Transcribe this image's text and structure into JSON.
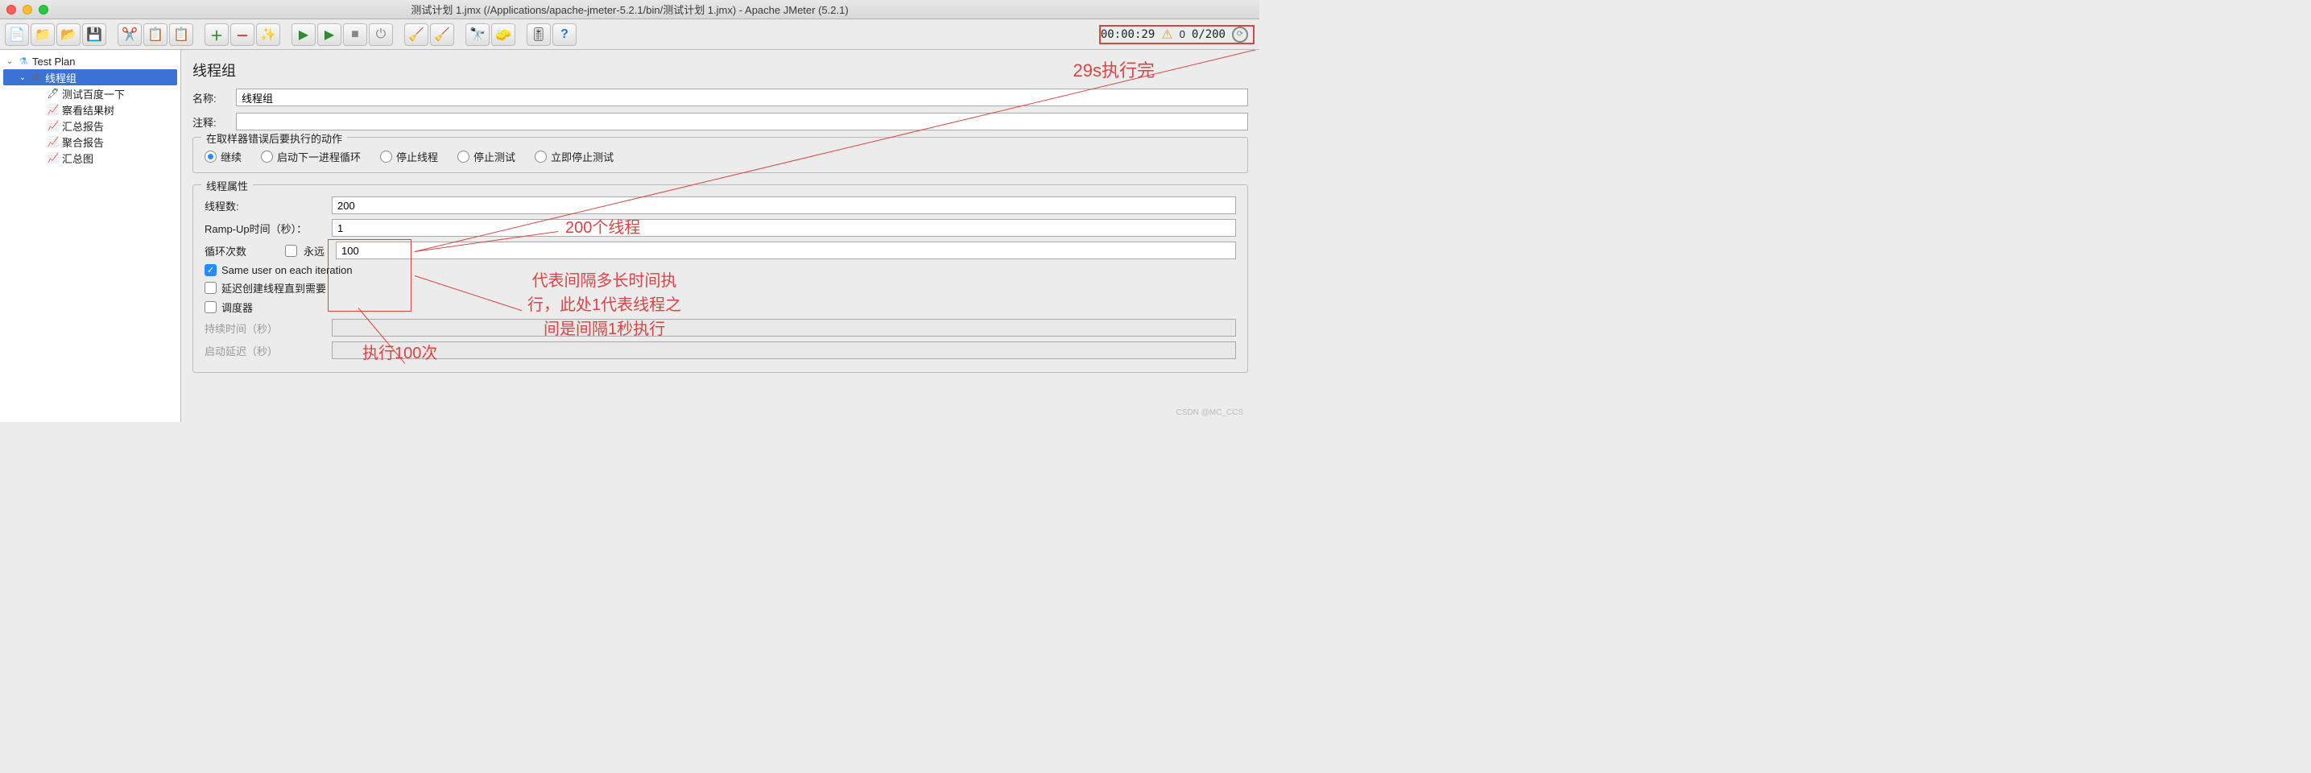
{
  "window": {
    "title": "测试计划 1.jmx (/Applications/apache-jmeter-5.2.1/bin/测试计划 1.jmx) - Apache JMeter (5.2.1)"
  },
  "status": {
    "elapsed": "00:00:29",
    "warn_count": "0",
    "thread_status": "0/200"
  },
  "tree": {
    "root": "Test Plan",
    "thread_group": "线程组",
    "sampler": "测试百度一下",
    "view_results": "察看结果树",
    "summary_report": "汇总报告",
    "aggregate_report": "聚合报告",
    "aggregate_graph": "汇总图"
  },
  "editor": {
    "title": "线程组",
    "name_label": "名称:",
    "name_value": "线程组",
    "comment_label": "注释:",
    "comment_value": "",
    "error_action": {
      "legend": "在取样器错误后要执行的动作",
      "continue": "继续",
      "next_loop": "启动下一进程循环",
      "stop_thread": "停止线程",
      "stop_test": "停止测试",
      "stop_now": "立即停止测试"
    },
    "thread_props": {
      "legend": "线程属性",
      "threads_label": "线程数:",
      "threads_value": "200",
      "ramp_label": "Ramp-Up时间（秒）：",
      "ramp_value": "1",
      "loops_label": "循环次数",
      "forever_label": "永远",
      "loops_value": "100",
      "same_user": "Same user on each iteration",
      "delay_create": "延迟创建线程直到需要",
      "scheduler": "调度器",
      "duration_label": "持续时间（秒）",
      "startup_delay_label": "启动延迟（秒）"
    }
  },
  "annotations": {
    "top_right": "29s执行完",
    "threads": "200个线程",
    "loops": "执行100次",
    "interval1": "代表间隔多长时间执",
    "interval2": "行，此处1代表线程之",
    "interval3": "间是间隔1秒执行"
  },
  "watermark": "CSDN @MC_CCS"
}
